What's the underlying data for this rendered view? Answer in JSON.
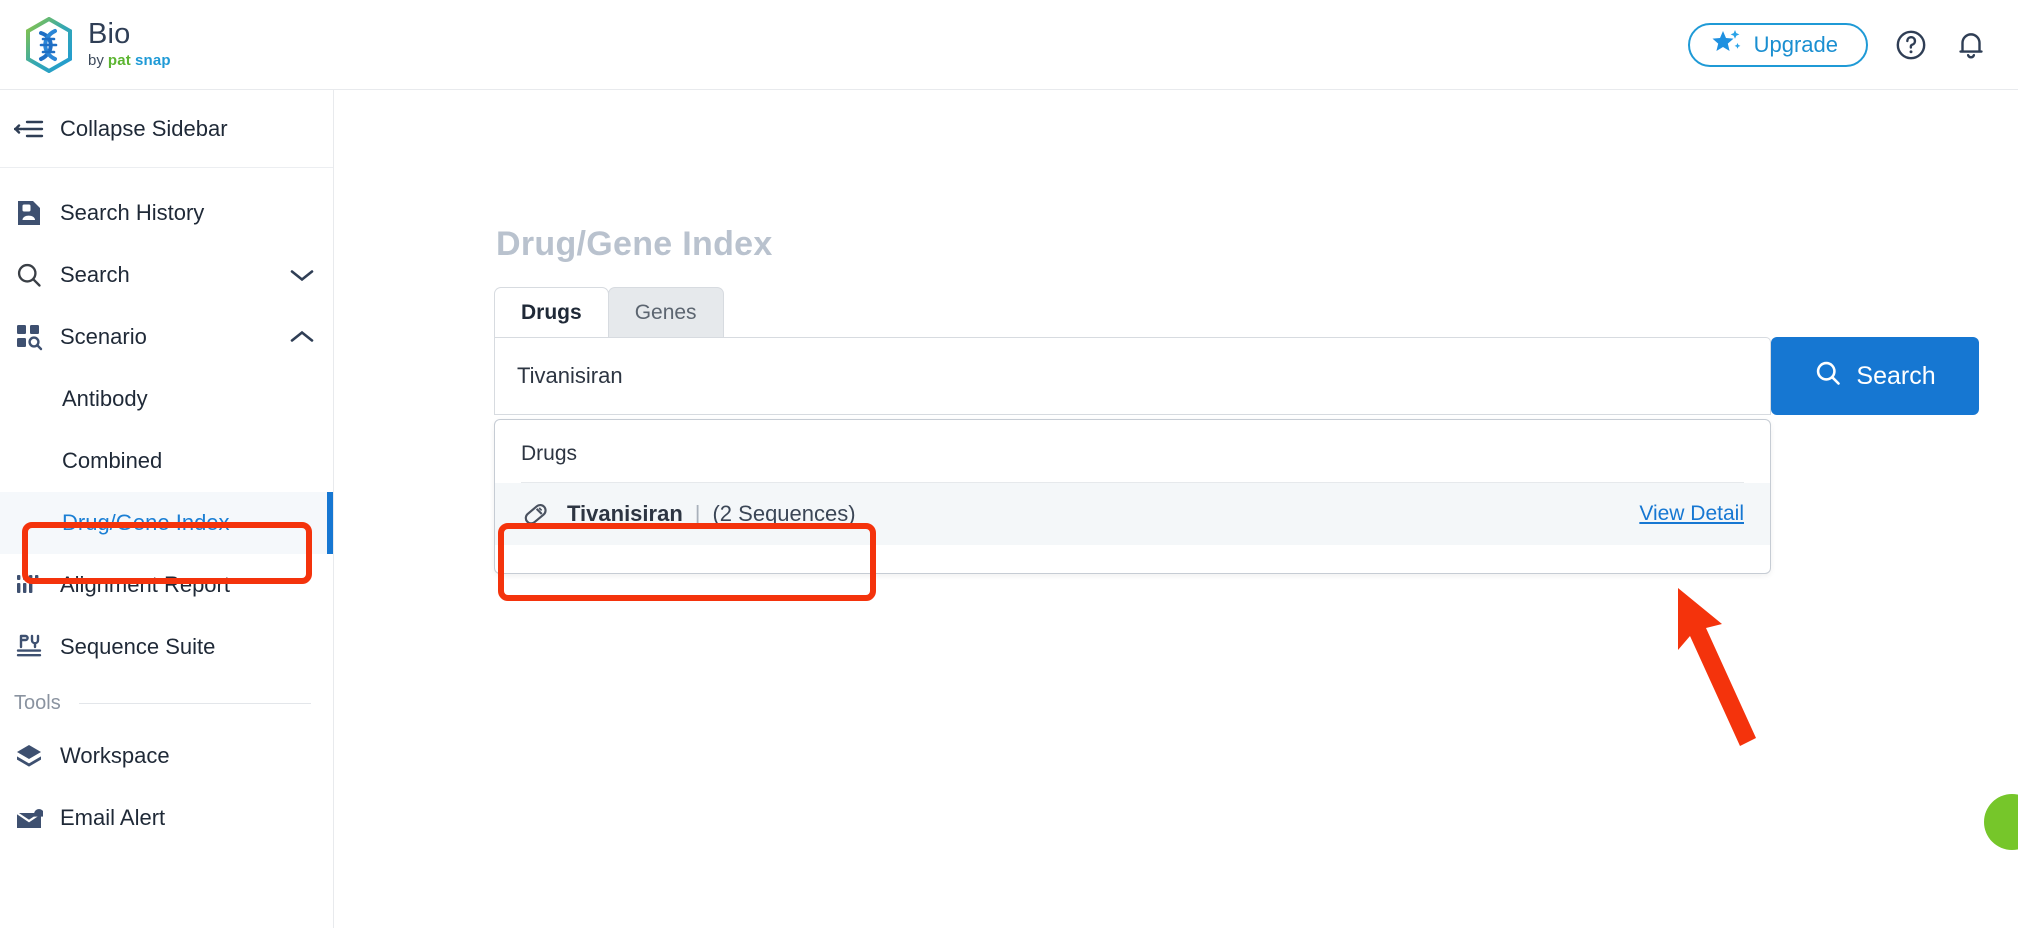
{
  "header": {
    "brand_title": "Bio",
    "brand_by": "by",
    "brand_pat": "pat",
    "brand_snap": "snap",
    "upgrade_label": "Upgrade",
    "help_icon": "help-circle-icon",
    "bell_icon": "bell-icon",
    "star_icon": "star-sparkle-icon",
    "accent_blue": "#1f9ad6"
  },
  "sidebar": {
    "collapse_label": "Collapse Sidebar",
    "items": [
      {
        "label": "Search History",
        "icon": "document-history-icon",
        "chevron": ""
      },
      {
        "label": "Search",
        "icon": "magnifier-icon",
        "chevron": "down"
      },
      {
        "label": "Scenario",
        "icon": "grid-search-icon",
        "chevron": "up"
      }
    ],
    "scenario_children": [
      {
        "label": "Antibody",
        "active": false
      },
      {
        "label": "Combined",
        "active": false
      },
      {
        "label": "Drug/Gene Index",
        "active": true
      }
    ],
    "items_after": [
      {
        "label": "Alignment Report",
        "icon": "barcode-icon"
      },
      {
        "label": "Sequence Suite",
        "icon": "tools-icon"
      }
    ],
    "tools_section_label": "Tools",
    "tools_items": [
      {
        "label": "Workspace",
        "icon": "cube-icon"
      },
      {
        "label": "Email Alert",
        "icon": "mail-alert-icon"
      }
    ],
    "active_color": "#1b7fd4"
  },
  "main": {
    "page_title": "Drug/Gene Index",
    "tabs": [
      {
        "label": "Drugs",
        "active": true
      },
      {
        "label": "Genes",
        "active": false
      }
    ],
    "search": {
      "value": "Tivanisiran",
      "placeholder": "",
      "button_label": "Search",
      "button_icon": "search-icon",
      "button_color": "#1677d2"
    },
    "dropdown": {
      "section_title": "Drugs",
      "results": [
        {
          "icon": "pill-capsule-icon",
          "name": "Tivanisiran",
          "divider": "|",
          "count": "(2 Sequences)",
          "link_label": "View Detail"
        }
      ]
    }
  },
  "annotations": {
    "color": "#f4330c",
    "boxes": [
      "sidebar-drug-gene-index",
      "dropdown-result-row"
    ],
    "arrow": "points-to-view-detail"
  },
  "fab": {
    "name": "help-chat-fab",
    "color": "#76c62a"
  }
}
